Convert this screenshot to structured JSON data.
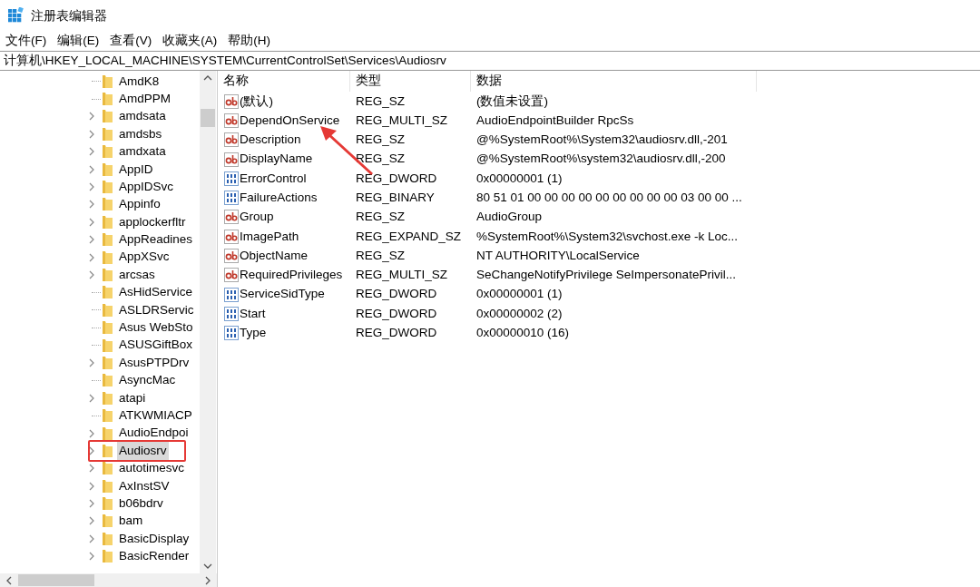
{
  "window": {
    "title": "注册表编辑器"
  },
  "menu": [
    "文件(F)",
    "编辑(E)",
    "查看(V)",
    "收藏夹(A)",
    "帮助(H)"
  ],
  "address": "计算机\\HKEY_LOCAL_MACHINE\\SYSTEM\\CurrentControlSet\\Services\\Audiosrv",
  "tree": [
    {
      "label": "AmdK8",
      "expandable": false,
      "selected": false
    },
    {
      "label": "AmdPPM",
      "expandable": false,
      "selected": false
    },
    {
      "label": "amdsata",
      "expandable": true,
      "selected": false
    },
    {
      "label": "amdsbs",
      "expandable": true,
      "selected": false
    },
    {
      "label": "amdxata",
      "expandable": true,
      "selected": false
    },
    {
      "label": "AppID",
      "expandable": true,
      "selected": false
    },
    {
      "label": "AppIDSvc",
      "expandable": true,
      "selected": false
    },
    {
      "label": "Appinfo",
      "expandable": true,
      "selected": false
    },
    {
      "label": "applockerfltr",
      "expandable": true,
      "selected": false
    },
    {
      "label": "AppReadines",
      "expandable": true,
      "selected": false
    },
    {
      "label": "AppXSvc",
      "expandable": true,
      "selected": false
    },
    {
      "label": "arcsas",
      "expandable": true,
      "selected": false
    },
    {
      "label": "AsHidService",
      "expandable": false,
      "selected": false
    },
    {
      "label": "ASLDRServic",
      "expandable": false,
      "selected": false
    },
    {
      "label": "Asus WebSto",
      "expandable": false,
      "selected": false
    },
    {
      "label": "ASUSGiftBox",
      "expandable": false,
      "selected": false
    },
    {
      "label": "AsusPTPDrv",
      "expandable": true,
      "selected": false
    },
    {
      "label": "AsyncMac",
      "expandable": false,
      "selected": false
    },
    {
      "label": "atapi",
      "expandable": true,
      "selected": false
    },
    {
      "label": "ATKWMIACP",
      "expandable": false,
      "selected": false
    },
    {
      "label": "AudioEndpoi",
      "expandable": true,
      "selected": false
    },
    {
      "label": "Audiosrv",
      "expandable": true,
      "selected": true
    },
    {
      "label": "autotimesvc",
      "expandable": true,
      "selected": false
    },
    {
      "label": "AxInstSV",
      "expandable": true,
      "selected": false
    },
    {
      "label": "b06bdrv",
      "expandable": true,
      "selected": false
    },
    {
      "label": "bam",
      "expandable": true,
      "selected": false
    },
    {
      "label": "BasicDisplay",
      "expandable": true,
      "selected": false
    },
    {
      "label": "BasicRender",
      "expandable": true,
      "selected": false
    }
  ],
  "columns": [
    "名称",
    "类型",
    "数据"
  ],
  "values": [
    {
      "kind": "string",
      "name": "(默认)",
      "type": "REG_SZ",
      "data": "(数值未设置)"
    },
    {
      "kind": "string",
      "name": "DependOnService",
      "type": "REG_MULTI_SZ",
      "data": "AudioEndpointBuilder RpcSs"
    },
    {
      "kind": "string",
      "name": "Description",
      "type": "REG_SZ",
      "data": "@%SystemRoot%\\System32\\audiosrv.dll,-201"
    },
    {
      "kind": "string",
      "name": "DisplayName",
      "type": "REG_SZ",
      "data": "@%SystemRoot%\\system32\\audiosrv.dll,-200"
    },
    {
      "kind": "binary",
      "name": "ErrorControl",
      "type": "REG_DWORD",
      "data": "0x00000001 (1)"
    },
    {
      "kind": "binary",
      "name": "FailureActions",
      "type": "REG_BINARY",
      "data": "80 51 01 00 00 00 00 00 00 00 00 00 03 00 00 ..."
    },
    {
      "kind": "string",
      "name": "Group",
      "type": "REG_SZ",
      "data": "AudioGroup"
    },
    {
      "kind": "string",
      "name": "ImagePath",
      "type": "REG_EXPAND_SZ",
      "data": "%SystemRoot%\\System32\\svchost.exe -k Loc..."
    },
    {
      "kind": "string",
      "name": "ObjectName",
      "type": "REG_SZ",
      "data": "NT AUTHORITY\\LocalService"
    },
    {
      "kind": "string",
      "name": "RequiredPrivileges",
      "type": "REG_MULTI_SZ",
      "data": "SeChangeNotifyPrivilege SeImpersonatePrivil..."
    },
    {
      "kind": "binary",
      "name": "ServiceSidType",
      "type": "REG_DWORD",
      "data": "0x00000001 (1)"
    },
    {
      "kind": "binary",
      "name": "Start",
      "type": "REG_DWORD",
      "data": "0x00000002 (2)"
    },
    {
      "kind": "binary",
      "name": "Type",
      "type": "REG_DWORD",
      "data": "0x00000010 (16)"
    }
  ]
}
